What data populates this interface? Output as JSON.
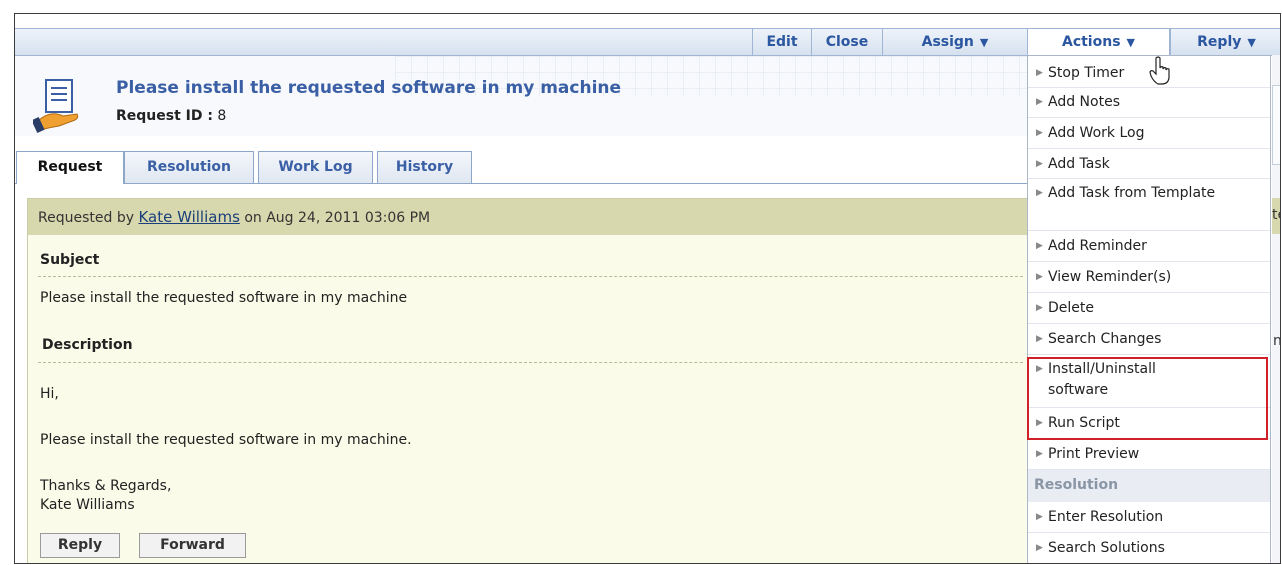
{
  "toolbar": {
    "edit": "Edit",
    "close": "Close",
    "assign": "Assign",
    "actions": "Actions",
    "reply": "Reply"
  },
  "request": {
    "title": "Please install the requested software in my machine",
    "id_label": "Request ID :",
    "id_value": "8"
  },
  "tabs": [
    "Request",
    "Resolution",
    "Work Log",
    "History"
  ],
  "panel": {
    "requested_by_prefix": "Requested by",
    "requester": "Kate Williams",
    "requested_on": "on Aug 24, 2011 03:06 PM",
    "subject_label": "Subject",
    "subject_text": "Please install the requested software in my machine",
    "description_label": "Description",
    "desc_line1": "Hi,",
    "desc_line2": "Please install the requested software in my machine.",
    "desc_line3": "Thanks & Regards,",
    "desc_line4": "Kate Williams",
    "reply_button": "Reply",
    "forward_button": "Forward"
  },
  "strip": {
    "c1": "te",
    "c2": "n"
  },
  "menu": {
    "items": [
      "Stop Timer",
      "Add Notes",
      "Add Work Log",
      "Add Task",
      "Add Task from Template",
      "Add Reminder",
      "View Reminder(s)",
      "Delete",
      "Search Changes",
      "Install/Uninstall software",
      "Run Script",
      "Print Preview"
    ],
    "section": "Resolution",
    "resolution_items": [
      "Enter Resolution",
      "Search Solutions"
    ]
  },
  "colors": {
    "link": "#3b5fa5",
    "highlight": "#d0202a",
    "panel_header": "#d8d8ae"
  }
}
